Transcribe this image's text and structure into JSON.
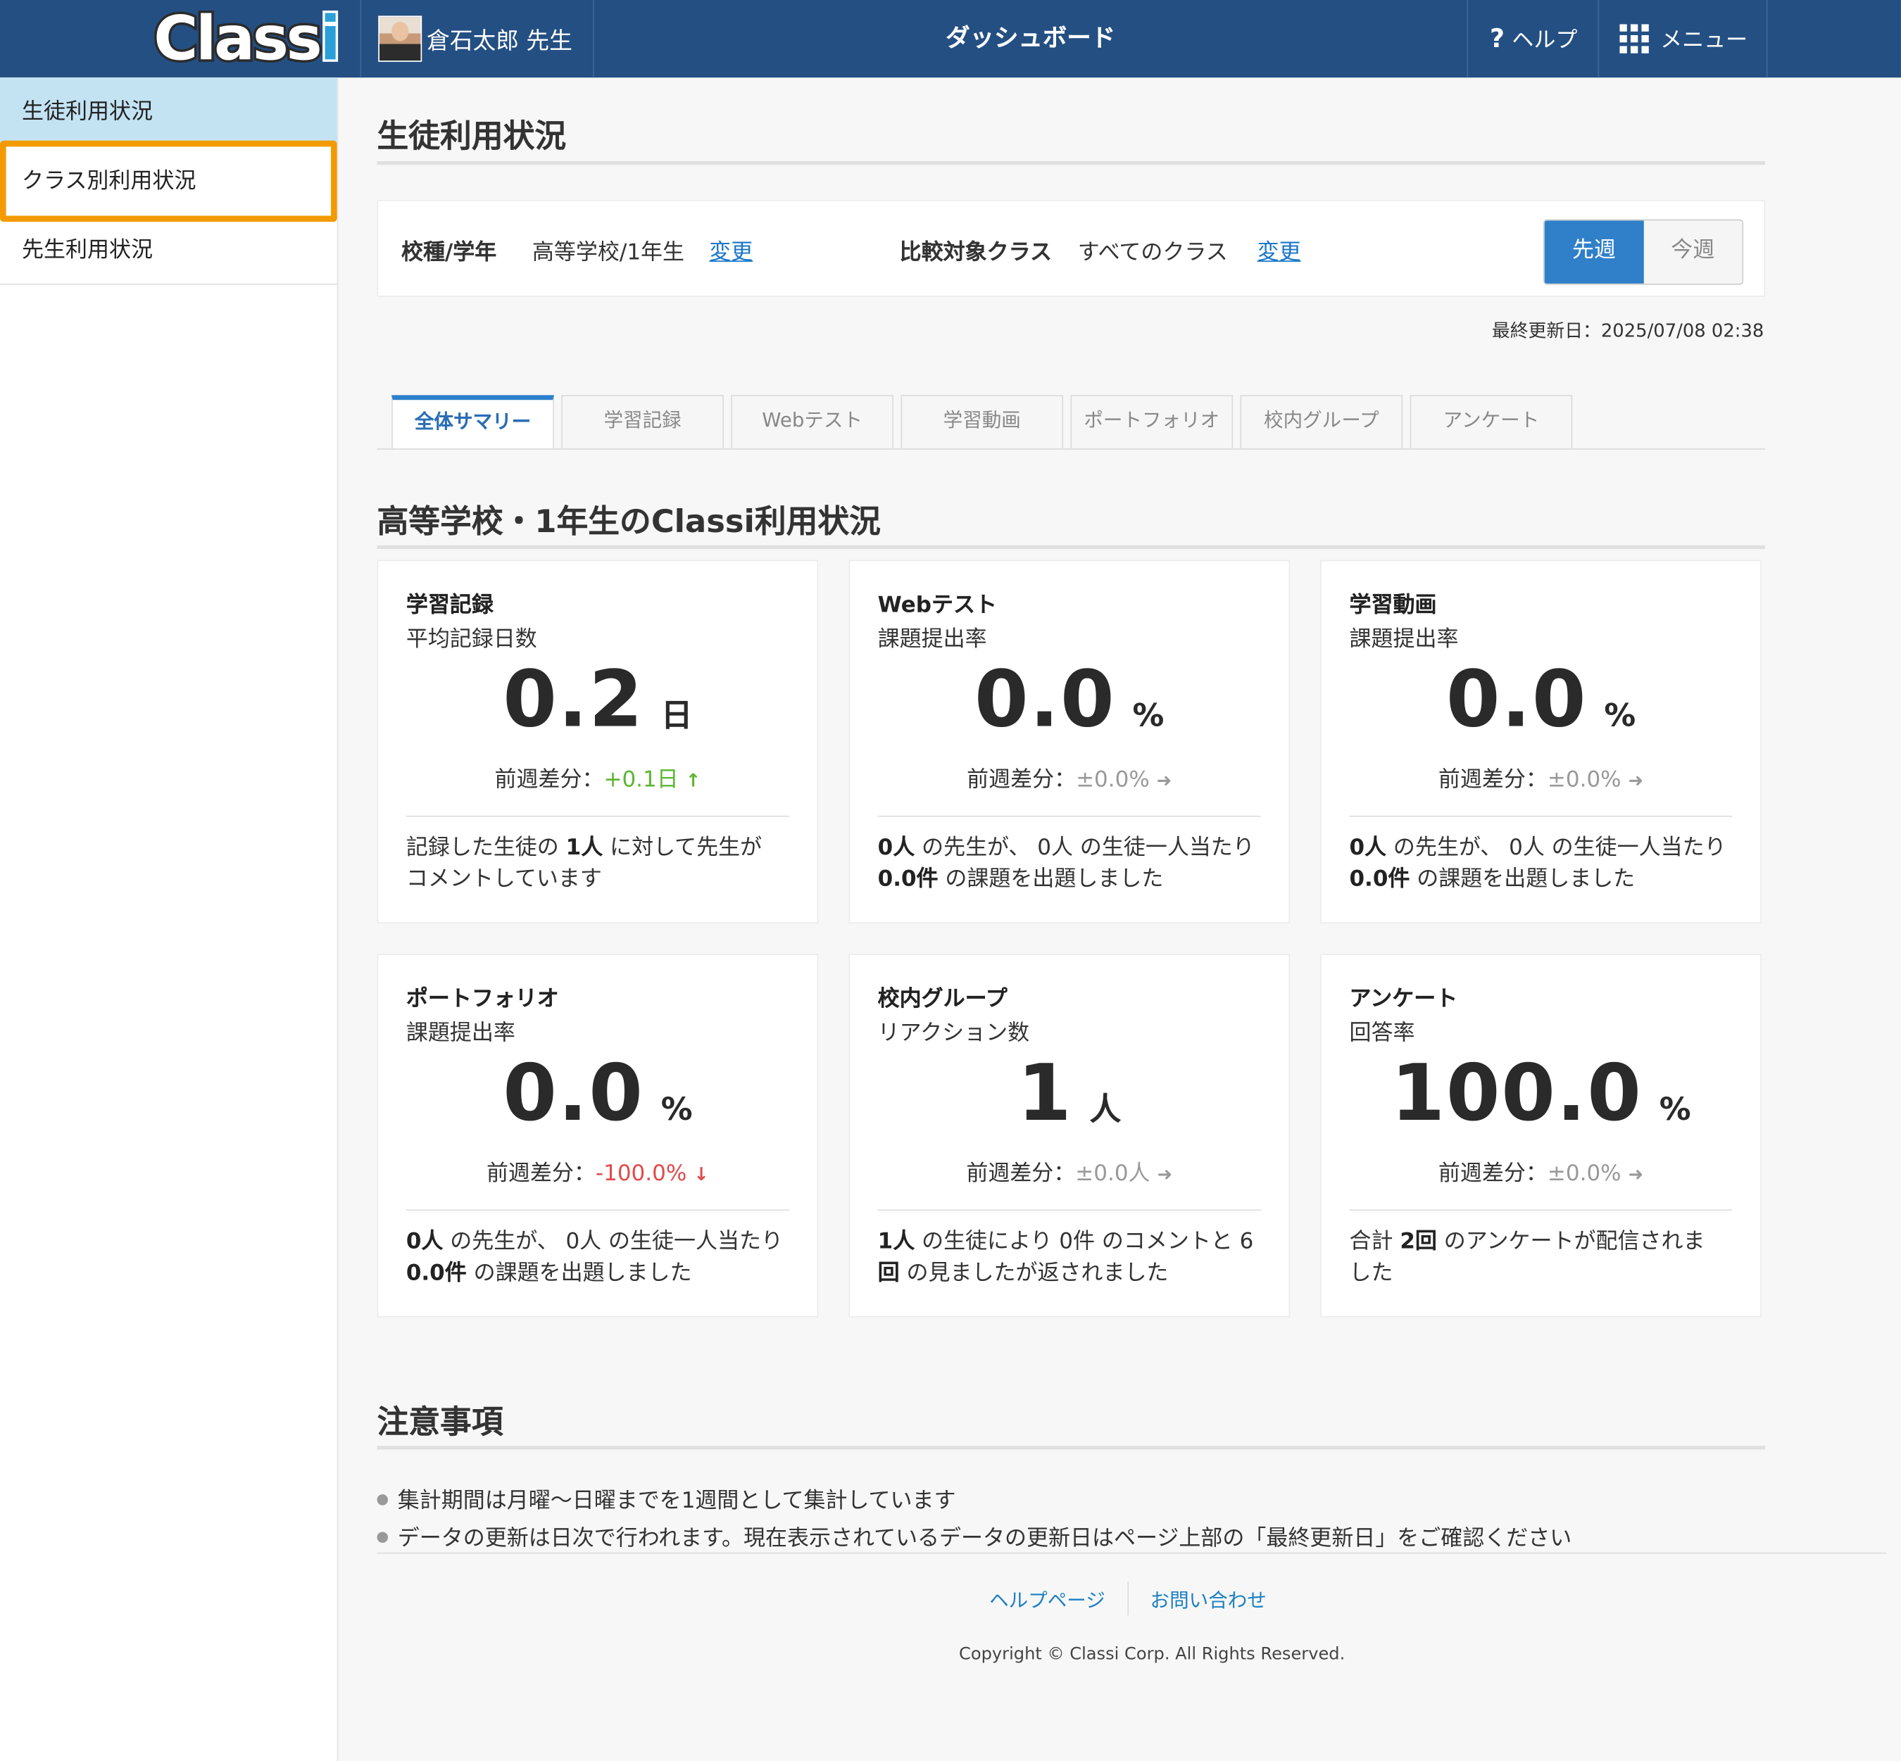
{
  "header": {
    "logo": "Classi",
    "user_name": "倉石太郎 先生",
    "title": "ダッシュボード",
    "help_label": "ヘルプ",
    "menu_label": "メニュー"
  },
  "sidebar": {
    "items": [
      {
        "label": "生徒利用状況"
      },
      {
        "label": "クラス別利用状況"
      },
      {
        "label": "先生利用状況"
      }
    ]
  },
  "main": {
    "title": "生徒利用状況",
    "filter": {
      "school_label": "校種/学年",
      "school_value": "高等学校/1年生",
      "school_change": "変更",
      "compare_label": "比較対象クラス",
      "compare_value": "すべてのクラス",
      "compare_change": "変更",
      "last_week": "先週",
      "this_week": "今週"
    },
    "last_updated": "最終更新日：2025/07/08 02:38",
    "tabs": [
      "全体サマリー",
      "学習記録",
      "Webテスト",
      "学習動画",
      "ポートフォリオ",
      "校内グループ",
      "アンケート"
    ],
    "section_title": "高等学校・1年生のClassi利用状況",
    "cards": [
      {
        "title": "学習記録",
        "subtitle": "平均記録日数",
        "value": "0.2",
        "unit": "日",
        "diff_label": "前週差分：",
        "diff_value": "+0.1日",
        "diff_arrow": "↑",
        "b1": "記録した生徒の ",
        "b1b": "1人",
        "b1c": " に対して先生が",
        "b2": "コメントしています",
        "b2b": "",
        "b2c": ""
      },
      {
        "title": "Webテスト",
        "subtitle": "課題提出率",
        "value": "0.0",
        "unit": "%",
        "diff_label": "前週差分：",
        "diff_value": "±0.0%",
        "diff_arrow": "➜",
        "b1": "",
        "b1b": "0人",
        "b1c": " の先生が、 0人 の生徒一人当たり",
        "b2": "",
        "b2b": "0.0件",
        "b2c": " の課題を出題しました"
      },
      {
        "title": "学習動画",
        "subtitle": "課題提出率",
        "value": "0.0",
        "unit": "%",
        "diff_label": "前週差分：",
        "diff_value": "±0.0%",
        "diff_arrow": "➜",
        "b1": "",
        "b1b": "0人",
        "b1c": " の先生が、 0人 の生徒一人当たり",
        "b2": "",
        "b2b": "0.0件",
        "b2c": " の課題を出題しました"
      },
      {
        "title": "ポートフォリオ",
        "subtitle": "課題提出率",
        "value": "0.0",
        "unit": "%",
        "diff_label": "前週差分：",
        "diff_value": "-100.0%",
        "diff_arrow": "↓",
        "b1": "",
        "b1b": "0人",
        "b1c": " の先生が、 0人 の生徒一人当たり",
        "b2": "",
        "b2b": "0.0件",
        "b2c": " の課題を出題しました"
      },
      {
        "title": "校内グループ",
        "subtitle": "リアクション数",
        "value": "1",
        "unit": "人",
        "diff_label": "前週差分：",
        "diff_value": "±0.0人",
        "diff_arrow": "➜",
        "b1": "",
        "b1b": "1人",
        "b1c": " の生徒により 0件 のコメントと 6",
        "b2": "",
        "b2b": "回",
        "b2c": " の見ましたが返されました"
      },
      {
        "title": "アンケート",
        "subtitle": "回答率",
        "value": "100.0",
        "unit": "%",
        "diff_label": "前週差分：",
        "diff_value": "±0.0%",
        "diff_arrow": "➜",
        "b1": "合計 ",
        "b1b": "2回",
        "b1c": " のアンケートが配信されま",
        "b2": "した",
        "b2b": "",
        "b2c": ""
      }
    ],
    "notes_title": "注意事項",
    "notes": [
      "集計期間は月曜～日曜までを1週間として集計しています",
      "データの更新は日次で行われます。現在表示されているデータの更新日はページ上部の「最終更新日」をご確認ください"
    ]
  },
  "footer": {
    "help_link": "ヘルプページ",
    "contact_link": "お問い合わせ",
    "copyright": "Copyright © Classi Corp. All Rights Reserved."
  },
  "colors": {
    "header_bg": "#244f82",
    "accent": "#2f7fc9",
    "highlight": "#f29a00",
    "up": "#5cb531",
    "down": "#e24a4a"
  }
}
